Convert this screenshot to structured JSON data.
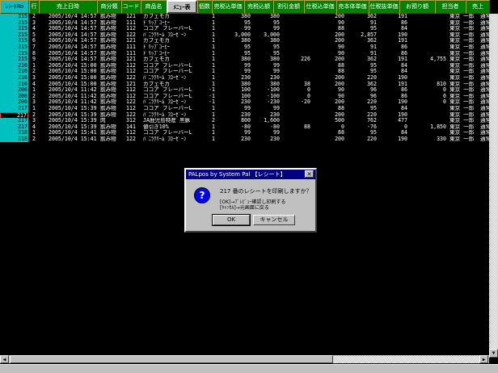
{
  "columns": {
    "receipt_no": "ﾚｼｰﾄNo",
    "line": "行",
    "date": "売上日時",
    "category": "商分類",
    "code": "コード",
    "item_name": "商品名",
    "menu": "ﾒﾆｭｰ表",
    "qty": "個数",
    "tax_incl_unit": "売税込単価",
    "tax_incl_total": "売税込額",
    "discount": "割引金額",
    "tax_excl_unit": "仕税込単価",
    "unit_price": "売本体単価",
    "cost_unit": "仕税抜単価",
    "received": "お預り額",
    "staff": "担当者",
    "sales": "売上"
  },
  "rows": [
    {
      "rid": "215",
      "ln": "2",
      "dt": "2005/10/4 14:57",
      "cat": "飲み物",
      "code": "121",
      "name": "カフェモカ",
      "qty": "1",
      "p1": "380",
      "p2": "380",
      "p3": "",
      "p4": "200",
      "p5": "362",
      "p6": "191",
      "p7": "",
      "staff": "東京 一郎",
      "type": "通常"
    },
    {
      "rid": "215",
      "ln": "3",
      "dt": "2005/10/4 14:57",
      "cat": "飲み物",
      "code": "111",
      "name": "ﾄﾞﾘｯﾌﾟｺｰﾋｰ",
      "qty": "1",
      "p1": "95",
      "p2": "95",
      "p3": "",
      "p4": "90",
      "p5": "91",
      "p6": "86",
      "p7": "",
      "staff": "東京 一郎",
      "type": "通常"
    },
    {
      "rid": "215",
      "ln": "4",
      "dt": "2005/10/4 14:57",
      "cat": "飲み物",
      "code": "112",
      "name": "ココア フレーバーL",
      "qty": "1",
      "p1": "99",
      "p2": "99",
      "p3": "",
      "p4": "88",
      "p5": "95",
      "p6": "84",
      "p7": "",
      "staff": "東京 一郎",
      "type": "通常"
    },
    {
      "rid": "215",
      "ln": "5",
      "dt": "2005/10/4 14:57",
      "cat": "飲み物",
      "code": "122",
      "name": "ﾊﾞﾆﾗｸﾘｰﾑ ﾌﾛｰｾﾞｰﾝ",
      "qty": "1",
      "p1": "3,000",
      "p2": "3,000",
      "p3": "",
      "p4": "200",
      "p5": "2,857",
      "p6": "190",
      "p7": "",
      "staff": "東京 一郎",
      "type": "通常"
    },
    {
      "rid": "215",
      "ln": "6",
      "dt": "2005/10/4 14:57",
      "cat": "飲み物",
      "code": "121",
      "name": "カフェモカ",
      "qty": "1",
      "p1": "380",
      "p2": "380",
      "p3": "",
      "p4": "200",
      "p5": "362",
      "p6": "191",
      "p7": "",
      "staff": "東京 一郎",
      "type": "通常"
    },
    {
      "rid": "215",
      "ln": "7",
      "dt": "2005/10/4 14:57",
      "cat": "飲み物",
      "code": "111",
      "name": "ﾄﾞﾘｯﾌﾟｺｰﾋｰ",
      "qty": "1",
      "p1": "95",
      "p2": "95",
      "p3": "",
      "p4": "90",
      "p5": "91",
      "p6": "86",
      "p7": "",
      "staff": "東京 一郎",
      "type": "通常"
    },
    {
      "rid": "215",
      "ln": "8",
      "dt": "2005/10/4 14:57",
      "cat": "飲み物",
      "code": "111",
      "name": "ﾄﾞﾘｯﾌﾟｺｰﾋｰ",
      "qty": "1",
      "p1": "95",
      "p2": "95",
      "p3": "",
      "p4": "90",
      "p5": "91",
      "p6": "86",
      "p7": "",
      "staff": "東京 一郎",
      "type": "通常"
    },
    {
      "rid": "215",
      "ln": "9",
      "dt": "2005/10/4 14:57",
      "cat": "飲み物",
      "code": "121",
      "name": "カフェモカ",
      "qty": "1",
      "p1": "380",
      "p2": "380",
      "p3": "226",
      "p4": "200",
      "p5": "362",
      "p6": "191",
      "p7": "4,755",
      "staff": "東京 一郎",
      "type": "通常"
    },
    {
      "rid": "216",
      "ln": "1",
      "dt": "2005/10/4 15:00",
      "cat": "飲み物",
      "code": "112",
      "name": "ココア フレーバーL",
      "qty": "1",
      "p1": "99",
      "p2": "99",
      "p3": "",
      "p4": "88",
      "p5": "95",
      "p6": "84",
      "p7": "",
      "staff": "東京 一郎",
      "type": "通常"
    },
    {
      "rid": "216",
      "ln": "2",
      "dt": "2005/10/4 15:00",
      "cat": "飲み物",
      "code": "112",
      "name": "ココア フレーバーL",
      "qty": "1",
      "p1": "99",
      "p2": "99",
      "p3": "",
      "p4": "88",
      "p5": "95",
      "p6": "84",
      "p7": "",
      "staff": "東京 一郎",
      "type": "通常"
    },
    {
      "rid": "216",
      "ln": "3",
      "dt": "2005/10/4 15:00",
      "cat": "飲み物",
      "code": "122",
      "name": "ﾊﾞﾆﾗｸﾘｰﾑ ﾌﾛｰｾﾞｰﾝ",
      "qty": "1",
      "p1": "230",
      "p2": "230",
      "p3": "",
      "p4": "200",
      "p5": "220",
      "p6": "190",
      "p7": "",
      "staff": "東京 一郎",
      "type": "通常"
    },
    {
      "rid": "216",
      "ln": "4",
      "dt": "2005/10/4 15:00",
      "cat": "飲み物",
      "code": "121",
      "name": "カフェモカ",
      "qty": "1",
      "p1": "380",
      "p2": "380",
      "p3": "38",
      "p4": "200",
      "p5": "362",
      "p6": "191",
      "p7": "810",
      "staff": "東京 一郎",
      "type": "通常"
    },
    {
      "rid": "206",
      "ln": "1",
      "dt": "2005/10/4 11:42",
      "cat": "飲み物",
      "code": "112",
      "name": "ココア フレーバーL",
      "qty": "-1",
      "p1": "100",
      "p2": "-100",
      "p3": "0",
      "p4": "90",
      "p5": "96",
      "p6": "86",
      "p7": "0",
      "staff": "東京 一郎",
      "type": "通常"
    },
    {
      "rid": "206",
      "ln": "2",
      "dt": "2005/10/4 11:42",
      "cat": "飲み物",
      "code": "112",
      "name": "ココア フレーバーL",
      "qty": "-1",
      "p1": "100",
      "p2": "-100",
      "p3": "0",
      "p4": "90",
      "p5": "96",
      "p6": "86",
      "p7": "0",
      "staff": "東京 一郎",
      "type": "通常"
    },
    {
      "rid": "206",
      "ln": "3",
      "dt": "2005/10/4 11:42",
      "cat": "飲み物",
      "code": "122",
      "name": "ﾊﾞﾆﾗｸﾘｰﾑ ﾌﾛｰｾﾞｰﾝ",
      "qty": "-1",
      "p1": "230",
      "p2": "-230",
      "p3": "-20",
      "p4": "200",
      "p5": "220",
      "p6": "190",
      "p7": "0",
      "staff": "東京 一郎",
      "type": "通常"
    },
    {
      "rid": "217",
      "ln": "1",
      "dt": "2005/10/4 15:39",
      "cat": "飲み物",
      "code": "112",
      "name": "ココア フレーバーL",
      "qty": "1",
      "p1": "99",
      "p2": "99",
      "p3": "",
      "p4": "88",
      "p5": "95",
      "p6": "84",
      "p7": "",
      "staff": "東京 一郎",
      "type": "通常"
    },
    {
      "rid": "217",
      "ln": "2",
      "dt": "2005/10/4 15:39",
      "cat": "飲み物",
      "code": "122",
      "name": "ﾊﾞﾆﾗｸﾘｰﾑ ﾌﾛｰｾﾞｰﾝ",
      "qty": "1",
      "p1": "230",
      "p2": "230",
      "p3": "",
      "p4": "200",
      "p5": "220",
      "p6": "190",
      "p7": "",
      "staff": "東京 一郎",
      "type": "通常",
      "selected": true
    },
    {
      "rid": "217",
      "ln": "3",
      "dt": "2005/10/4 15:39",
      "cat": "肉",
      "code": "312",
      "name": "JA鹿児島特産 黒豚",
      "qty": "2",
      "p1": "800",
      "p2": "1,600",
      "p3": "",
      "p4": "500",
      "p5": "762",
      "p6": "477",
      "p7": "",
      "staff": "東京 一郎",
      "type": "通常"
    },
    {
      "rid": "217",
      "ln": "4",
      "dt": "2005/10/4 15:39",
      "cat": "飲み物",
      "code": "141",
      "name": "値引き10%",
      "qty": "1",
      "p1": "-80",
      "p2": "-80",
      "p3": "88",
      "p4": "0",
      "p5": "-76",
      "p6": "0",
      "p7": "1,850",
      "staff": "東京 一郎",
      "type": "通常"
    },
    {
      "rid": "218",
      "ln": "1",
      "dt": "2005/10/4 15:41",
      "cat": "飲み物",
      "code": "112",
      "name": "ココア フレーバーL",
      "qty": "1",
      "p1": "99",
      "p2": "99",
      "p3": "",
      "p4": "88",
      "p5": "95",
      "p6": "84",
      "p7": "",
      "staff": "東京 一郎",
      "type": "通常"
    },
    {
      "rid": "218",
      "ln": "2",
      "dt": "2005/10/4 15:41",
      "cat": "飲み物",
      "code": "122",
      "name": "ﾊﾞﾆﾗｸﾘｰﾑ ﾌﾛｰｾﾞｰﾝ",
      "qty": "1",
      "p1": "230",
      "p2": "230",
      "p3": "",
      "p4": "200",
      "p5": "220",
      "p6": "190",
      "p7": "330",
      "staff": "東京 一郎",
      "type": "通常"
    }
  ],
  "dialog": {
    "title": "PALpos by System Pal 【レシート】",
    "close": "✕",
    "icon": "question-icon",
    "message": "217 番のレシートを印刷しますか？",
    "detail1": "[OK]→ﾌﾟﾚﾋﾞｭｰ確認し印刷する",
    "detail2": "[ｷｬﾝｾﾙ]→元画面に戻る",
    "ok_label": "OK",
    "cancel_label": "キャンセル"
  },
  "colors": {
    "grid_bg": "#000000",
    "receipt_col": "#00c0c0",
    "header_bg": "#008000",
    "dialog_title": "#000080"
  }
}
